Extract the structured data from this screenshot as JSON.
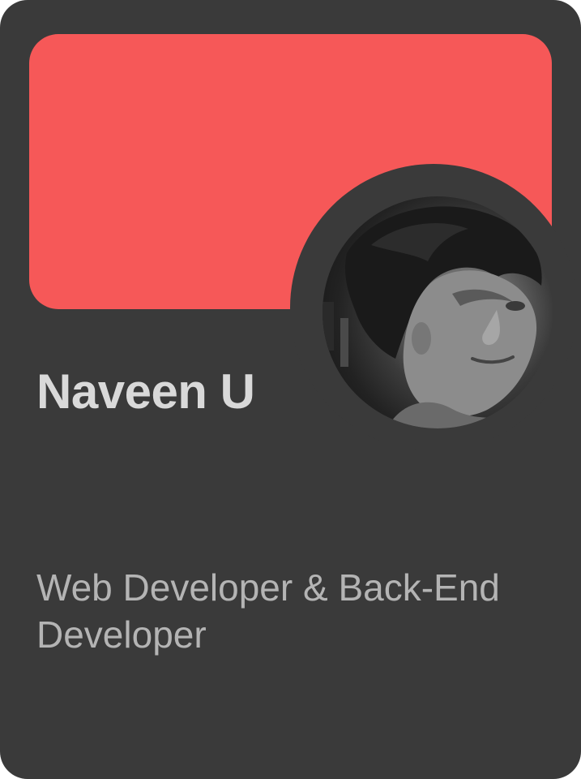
{
  "profile": {
    "name": "Naveen U",
    "role": "Web Developer & Back-End Developer"
  },
  "colors": {
    "card_background": "#3a3a3a",
    "banner": "#f65858",
    "name_text": "#d9d9d9",
    "role_text": "#b4b4b4"
  },
  "icons": {
    "avatar": "profile-photo"
  }
}
